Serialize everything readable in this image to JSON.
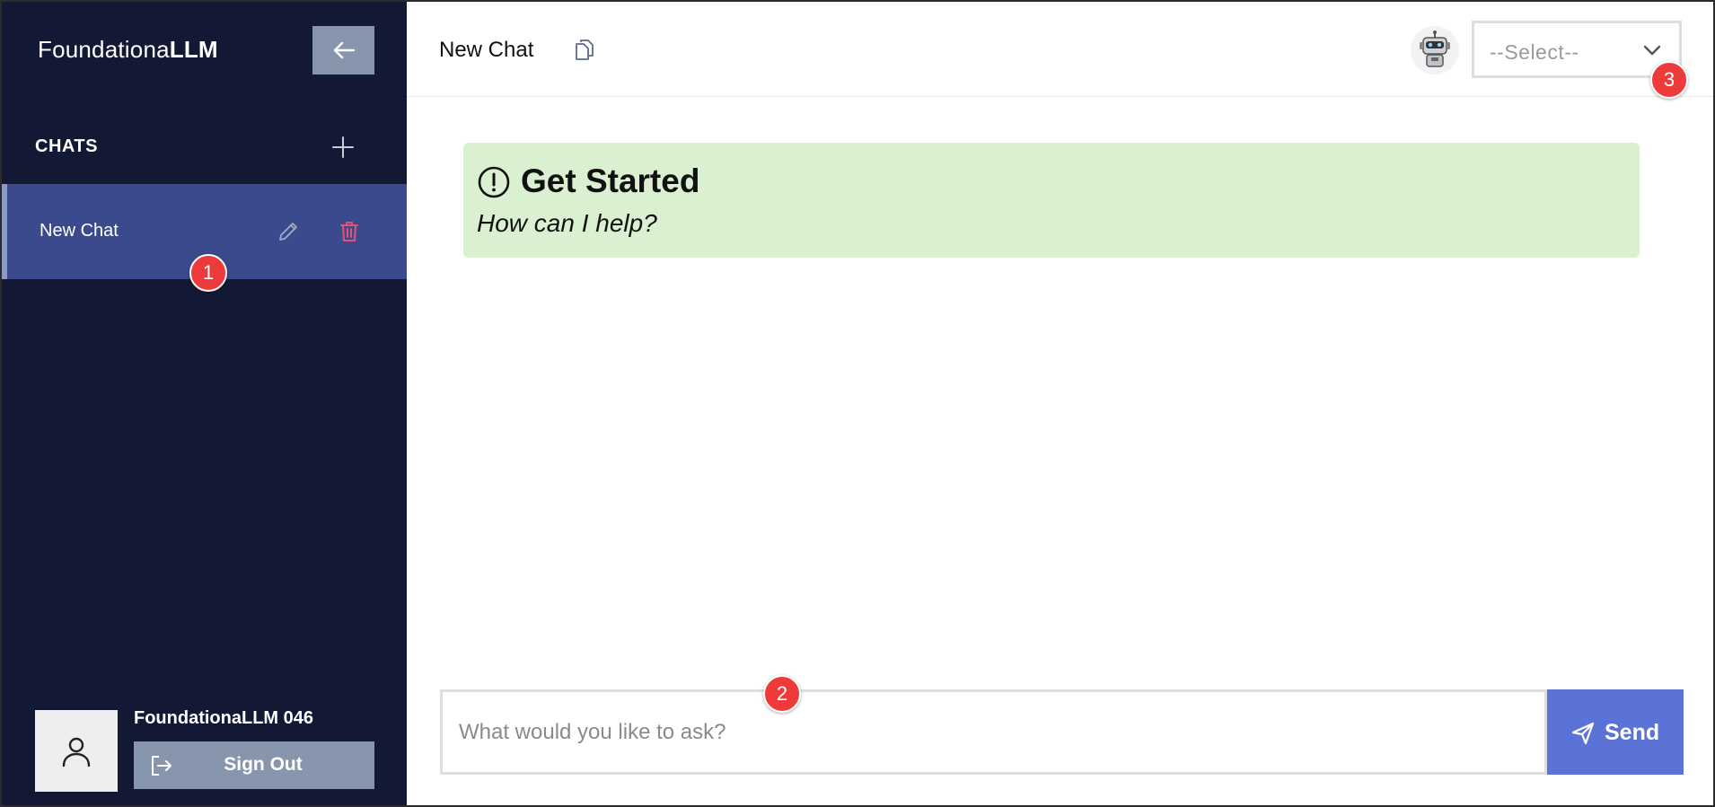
{
  "sidebar": {
    "brand_regular": "Foundationa",
    "brand_bold": "LLM",
    "chats_header": "CHATS",
    "chat_items": [
      {
        "label": "New Chat"
      }
    ],
    "user_name": "FoundationaLLM 046",
    "sign_out_label": "Sign Out"
  },
  "header": {
    "title": "New Chat",
    "agent_select": {
      "value": "--Select--"
    }
  },
  "get_started": {
    "title": "Get Started",
    "subtitle": "How can I help?"
  },
  "composer": {
    "placeholder": "What would you like to ask?",
    "send_label": "Send"
  },
  "callouts": [
    "1",
    "2",
    "3"
  ],
  "colors": {
    "sidebar_bg": "#131835",
    "selected_chat_bg": "#3b4a8c",
    "sidebar_button_bg": "#8896ad",
    "get_started_bg": "#d9f0d1",
    "send_button_bg": "#5b73d6",
    "delete_icon": "#e05576",
    "callout": "#ee3a3a"
  },
  "icons": {
    "collapse": "arrow-left-icon",
    "add_chat": "plus-icon",
    "edit": "pencil-icon",
    "delete": "trash-icon",
    "user": "user-icon",
    "sign_out": "sign-out-icon",
    "copy": "copy-icon",
    "agent": "robot-icon",
    "dropdown": "chevron-down-icon",
    "info": "exclamation-circle-icon",
    "send": "paper-plane-icon"
  }
}
